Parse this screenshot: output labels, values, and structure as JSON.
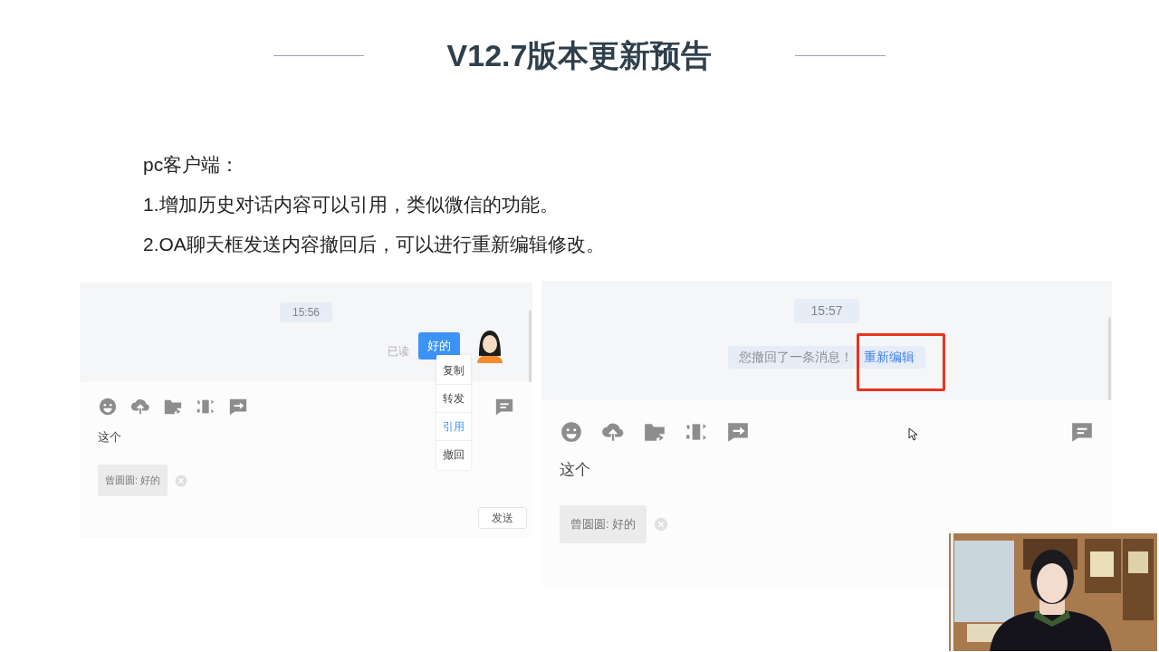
{
  "title": "V12.7版本更新预告",
  "intro": {
    "heading": "pc客户端：",
    "items": [
      "1.增加历史对话内容可以引用，类似微信的功能。",
      "2.OA聊天框发送内容撤回后，可以进行重新编辑修改。"
    ]
  },
  "left_chat": {
    "time": "15:56",
    "read_status": "已读",
    "message": "好的",
    "context_menu": [
      {
        "label": "复制",
        "selected": false
      },
      {
        "label": "转发",
        "selected": false
      },
      {
        "label": "引用",
        "selected": true
      },
      {
        "label": "撤回",
        "selected": false
      }
    ],
    "input_text": "这个",
    "quote": "曾圆圆: 好的",
    "send_button": "发送"
  },
  "right_chat": {
    "time": "15:57",
    "recall_notice": "您撤回了一条消息！",
    "reedit_link": "重新编辑",
    "highlighted": true,
    "input_text": "这个",
    "quote": "曾圆圆: 好的"
  }
}
